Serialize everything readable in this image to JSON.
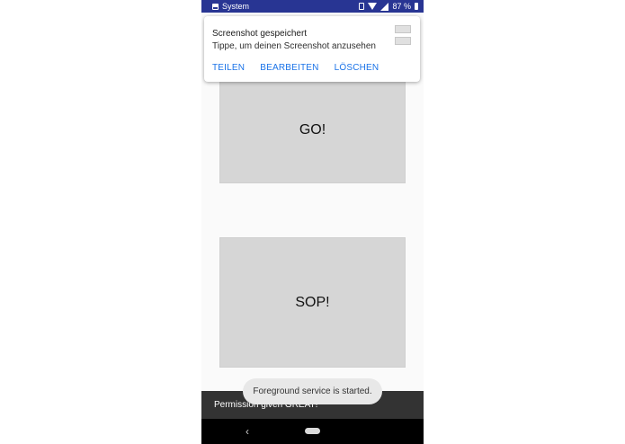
{
  "status_bar": {
    "app_label": "System",
    "battery": "87 %",
    "background_color": "#283593",
    "icons": [
      "image-icon",
      "vibrate-icon",
      "wifi-icon",
      "signal-icon",
      "battery-icon"
    ]
  },
  "notification": {
    "title": "Screenshot gespeichert",
    "text": "Tippe, um deinen Screenshot anzusehen",
    "actions": {
      "share": "TEILEN",
      "edit": "BEARBEITEN",
      "delete": "LÖSCHEN"
    },
    "action_color": "#1a73e8"
  },
  "main": {
    "go_button": "GO!",
    "sop_button": "SOP!"
  },
  "snackbar": {
    "text": "Permission given GREAT!"
  },
  "toast": {
    "text": "Foreground service is started."
  },
  "nav_bar": {
    "back_icon": "back-icon",
    "home_icon": "home-pill-icon"
  }
}
